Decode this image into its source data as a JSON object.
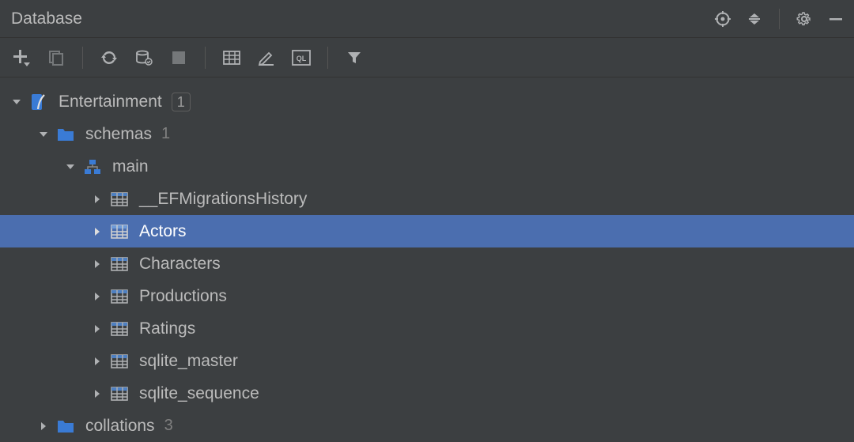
{
  "header": {
    "title": "Database"
  },
  "tree": {
    "database": {
      "label": "Entertainment",
      "count": "1"
    },
    "schemas": {
      "label": "schemas",
      "count": "1"
    },
    "schema_main": {
      "label": "main"
    },
    "tables": [
      {
        "label": "__EFMigrationsHistory"
      },
      {
        "label": "Actors"
      },
      {
        "label": "Characters"
      },
      {
        "label": "Productions"
      },
      {
        "label": "Ratings"
      },
      {
        "label": "sqlite_master"
      },
      {
        "label": "sqlite_sequence"
      }
    ],
    "collations": {
      "label": "collations",
      "count": "3"
    }
  }
}
